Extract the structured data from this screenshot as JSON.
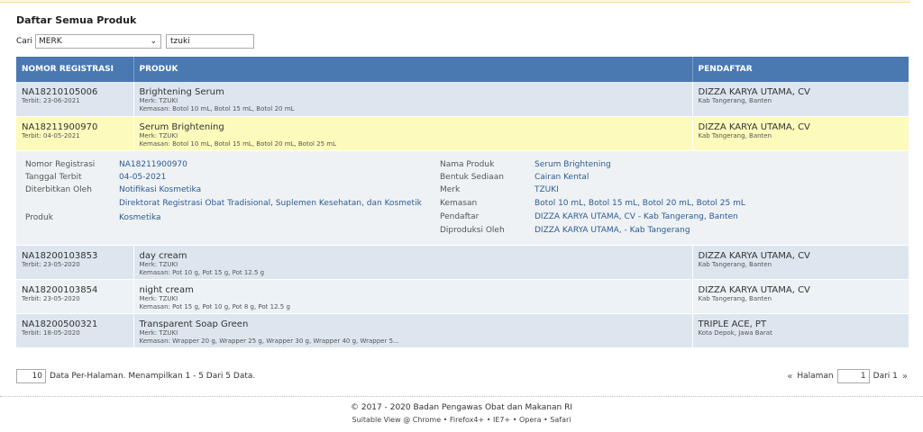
{
  "page_title": "Daftar Semua Produk",
  "search": {
    "label": "Cari",
    "field_selected": "MERK",
    "query": "tzuki"
  },
  "table": {
    "headers": [
      "NOMOR REGISTRASI",
      "PRODUK",
      "PENDAFTAR"
    ],
    "rows": [
      {
        "reg": "NA18210105006",
        "terbit": "Terbit: 23-06-2021",
        "produk": "Brightening Serum",
        "merk": "Merk: TZUKI",
        "kemasan": "Kemasan: Botol 10 mL, Botol 15 mL, Botol 20 mL",
        "pendaftar": "DIZZA KARYA UTAMA, CV",
        "lokasi": "Kab Tangerang, Banten"
      },
      {
        "reg": "NA18211900970",
        "terbit": "Terbit: 04-05-2021",
        "produk": "Serum Brightening",
        "merk": "Merk: TZUKI",
        "kemasan": "Kemasan: Botol 10 mL, Botol 15 mL, Botol 20 mL, Botol 25 mL",
        "pendaftar": "DIZZA KARYA UTAMA, CV",
        "lokasi": "Kab Tangerang, Banten"
      },
      {
        "reg": "NA18200103853",
        "terbit": "Terbit: 23-05-2020",
        "produk": "day cream",
        "merk": "Merk: TZUKI",
        "kemasan": "Kemasan: Pot 10 g, Pot 15 g, Pot 12.5 g",
        "pendaftar": "DIZZA KARYA UTAMA, CV",
        "lokasi": "Kab Tangerang, Banten"
      },
      {
        "reg": "NA18200103854",
        "terbit": "Terbit: 23-05-2020",
        "produk": "night cream",
        "merk": "Merk: TZUKI",
        "kemasan": "Kemasan: Pot 15 g, Pot 10 g, Pot 8 g, Pot 12.5 g",
        "pendaftar": "DIZZA KARYA UTAMA, CV",
        "lokasi": "Kab Tangerang, Banten"
      },
      {
        "reg": "NA18200500321",
        "terbit": "Terbit: 18-05-2020",
        "produk": "Transparent Soap Green",
        "merk": "Merk: TZUKI",
        "kemasan": "Kemasan: Wrapper 20 g, Wrapper 25 g, Wrapper 30 g, Wrapper 40 g, Wrapper 5...",
        "pendaftar": "TRIPLE ACE, PT",
        "lokasi": "Kota Depok, Jawa Barat"
      }
    ]
  },
  "detail": {
    "left": [
      {
        "label": "Nomor Registrasi",
        "value": "NA18211900970"
      },
      {
        "label": "Tanggal Terbit",
        "value": "04-05-2021"
      },
      {
        "label": "Diterbitkan Oleh",
        "value": "Notifikasi Kosmetika"
      },
      {
        "label": "",
        "value": "Direktorat Registrasi Obat Tradisional, Suplemen Kesehatan, dan Kosmetik"
      },
      {
        "label": "Produk",
        "value": "Kosmetika"
      }
    ],
    "right": [
      {
        "label": "Nama Produk",
        "value": "Serum Brightening"
      },
      {
        "label": "Bentuk Sediaan",
        "value": "Cairan Kental"
      },
      {
        "label": "Merk",
        "value": "TZUKI"
      },
      {
        "label": "Kemasan",
        "value": "Botol 10 mL, Botol 15 mL, Botol 20 mL, Botol 25 mL"
      },
      {
        "label": "Pendaftar",
        "value": "DIZZA KARYA UTAMA, CV - Kab Tangerang, Banten"
      },
      {
        "label": "Diproduksi Oleh",
        "value": "DIZZA KARYA UTAMA, - Kab Tangerang"
      }
    ]
  },
  "pager": {
    "per_page": "10",
    "summary": "Data Per-Halaman. Menampilkan 1 - 5 Dari 5 Data.",
    "prev": "«",
    "halaman_label": "Halaman",
    "page": "1",
    "of_label": "Dari 1",
    "next": "»"
  },
  "footer": {
    "copyright": "© 2017 - 2020  Badan Pengawas Obat dan Makanan RI",
    "suitable": "Suitable View @ Chrome • Firefox4+ • IE7+ • Opera • Safari"
  }
}
